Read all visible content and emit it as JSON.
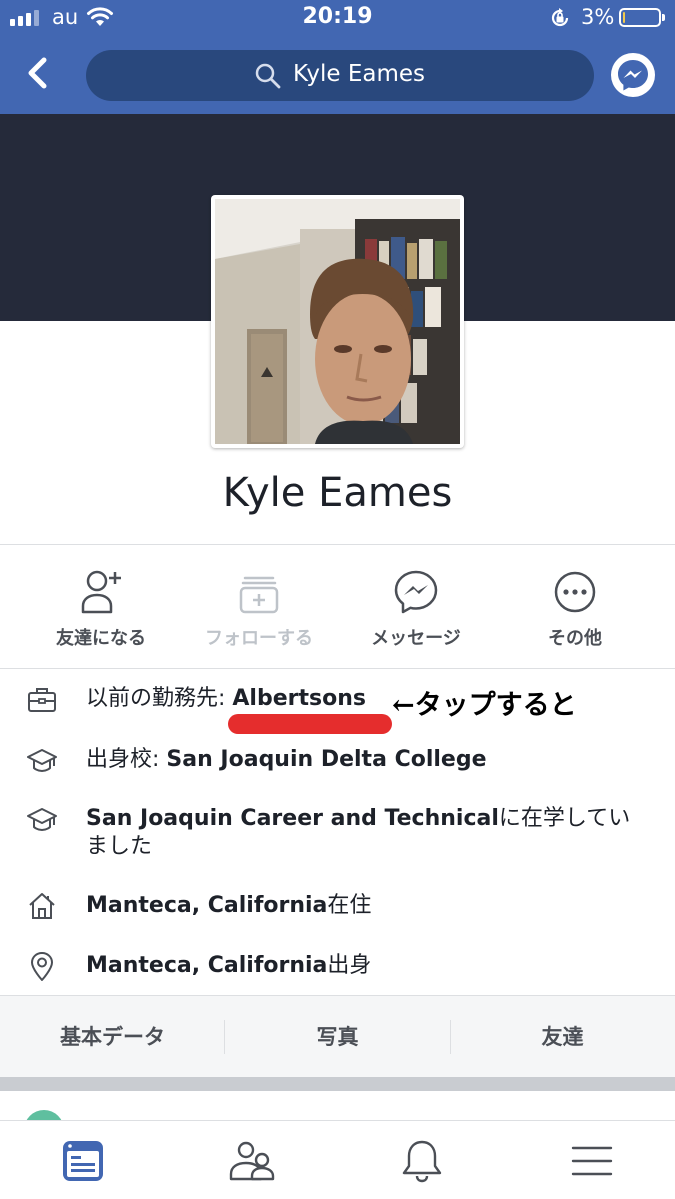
{
  "status_bar": {
    "carrier": "au",
    "time": "20:19",
    "battery_percent": "3%",
    "battery_level": 0.03,
    "icons": [
      "signal-icon",
      "wifi-icon",
      "rotation-lock-icon",
      "battery-icon"
    ]
  },
  "nav": {
    "back_icon": "chevron-left-icon",
    "search_query": "Kyle Eames",
    "messenger_icon": "messenger-icon",
    "colors": {
      "bar": "#4267b2",
      "search_bg": "#29487d"
    }
  },
  "profile": {
    "name": "Kyle Eames",
    "cover_color": "#252a3a"
  },
  "actions": [
    {
      "label": "友達になる",
      "icon": "add-friend-icon",
      "enabled": true
    },
    {
      "label": "フォローする",
      "icon": "follow-icon",
      "enabled": false
    },
    {
      "label": "メッセージ",
      "icon": "messenger-icon",
      "enabled": true
    },
    {
      "label": "その他",
      "icon": "more-icon",
      "enabled": true
    }
  ],
  "intro": {
    "work": {
      "prefix": "以前の勤務先: ",
      "value": "Albertsons",
      "icon": "briefcase-icon"
    },
    "annotation": "←タップすると",
    "school": {
      "prefix": "出身校: ",
      "value": "San Joaquin Delta College",
      "icon": "graduation-cap-icon"
    },
    "study": {
      "value": "San Joaquin Career and Technical",
      "suffix": "に在学していました",
      "icon": "graduation-cap-icon"
    },
    "lives": {
      "value": "Manteca, California",
      "suffix": "在住",
      "icon": "home-icon"
    },
    "from": {
      "value": "Manteca, California",
      "suffix": "出身",
      "icon": "location-pin-icon"
    },
    "highlight_color": "#e52d2d"
  },
  "tabs": [
    {
      "label": "基本データ"
    },
    {
      "label": "写真"
    },
    {
      "label": "友達"
    }
  ],
  "bottom_nav": [
    {
      "icon": "news-feed-icon",
      "active": true
    },
    {
      "icon": "friends-icon",
      "active": false
    },
    {
      "icon": "bell-icon",
      "active": false
    },
    {
      "icon": "menu-icon",
      "active": false
    }
  ]
}
